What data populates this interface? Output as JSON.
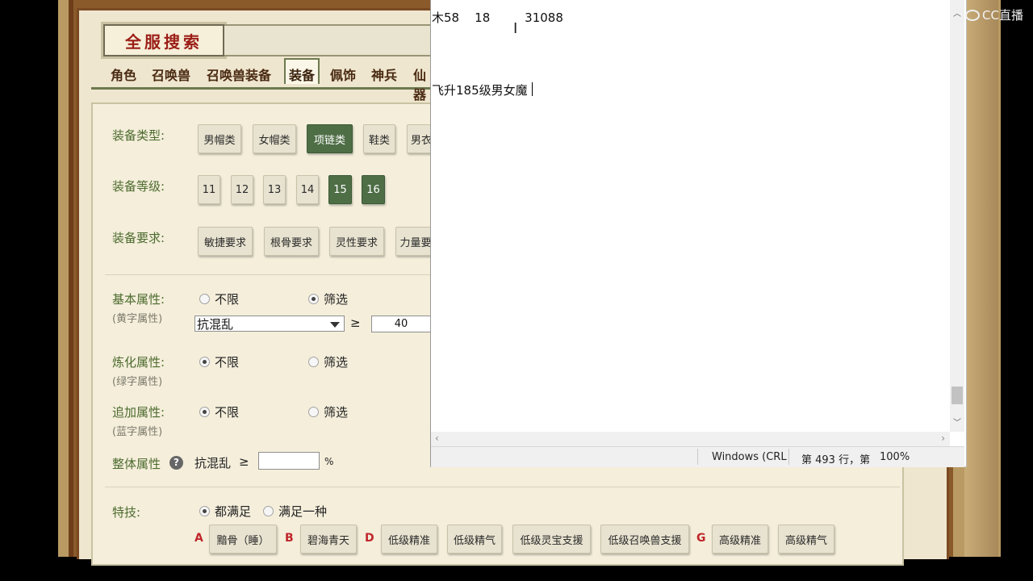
{
  "game": {
    "title": "全服搜索",
    "tabs": [
      "角色",
      "召唤兽",
      "召唤兽装备",
      "装备",
      "佩饰",
      "神兵",
      "仙器"
    ],
    "active_tab": "装备",
    "equip_type_label": "装备类型:",
    "equip_types": [
      "男帽类",
      "女帽类",
      "项链类",
      "鞋类",
      "男衣"
    ],
    "equip_level_label": "装备等级:",
    "equip_levels": [
      "11",
      "12",
      "13",
      "14",
      "15",
      "16"
    ],
    "equip_req_label": "装备要求:",
    "equip_reqs": [
      "敏捷要求",
      "根骨要求",
      "灵性要求",
      "力量要"
    ],
    "basic_label": "基本属性:",
    "basic_sub": "(黄字属性)",
    "unlimited": "不限",
    "filter": "筛选",
    "attr_select": "抗混乱",
    "gte": "≥",
    "basic_value": "40",
    "refine_label": "炼化属性:",
    "refine_sub": "(绿字属性)",
    "extra_label": "追加属性:",
    "extra_sub": "(蓝字属性)",
    "overall_label": "整体属性",
    "help": "?",
    "overall_attr": "抗混乱",
    "overall_value": "",
    "percent": "%",
    "skill_label": "特技:",
    "all_satisfy": "都满足",
    "any_one": "满足一种",
    "skill_groups": [
      {
        "letter": "A",
        "items": [
          "黯骨（睡）"
        ]
      },
      {
        "letter": "B",
        "items": [
          "碧海青天"
        ]
      },
      {
        "letter": "D",
        "items": [
          "低级精准",
          "低级精气",
          "低级灵宝支援",
          "低级召唤兽支援"
        ]
      },
      {
        "letter": "G",
        "items": [
          "高级精准",
          "高级精气"
        ]
      }
    ]
  },
  "notepad": {
    "line1": "木58    18         31088",
    "line2": "飞升185级男女魔",
    "status_encoding": "Windows (CRL",
    "status_pos": "第 493 行，第",
    "status_zoom": "100%"
  },
  "watermark": "CC直播"
}
